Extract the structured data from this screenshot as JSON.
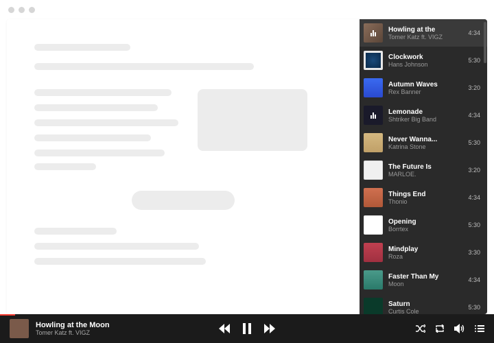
{
  "now_playing": {
    "title": "Howling at the Moon",
    "artist": "Tomer Katz ft. VIGZ"
  },
  "queue": [
    {
      "title": "Howling at the",
      "artist": "Tomer Katz ft. VIGZ",
      "duration": "4:34",
      "art": "art-a",
      "active": true,
      "playing": true
    },
    {
      "title": "Clockwork",
      "artist": "Hans Johnson",
      "duration": "5:30",
      "art": "art-b"
    },
    {
      "title": "Autumn Waves",
      "artist": "Rex Banner",
      "duration": "3:20",
      "art": "art-c"
    },
    {
      "title": "Lemonade",
      "artist": "Shtriker Big Band",
      "duration": "4:34",
      "art": "art-d",
      "playing": true
    },
    {
      "title": "Never Wanna...",
      "artist": "Katrina Stone",
      "duration": "5:30",
      "art": "art-e"
    },
    {
      "title": "The Future Is",
      "artist": "MARLOE.",
      "duration": "3:20",
      "art": "art-f"
    },
    {
      "title": "Things End",
      "artist": "Thonio",
      "duration": "4:34",
      "art": "art-g"
    },
    {
      "title": "Opening",
      "artist": "Borrtex",
      "duration": "5:30",
      "art": "art-h"
    },
    {
      "title": "Mindplay",
      "artist": "Roza",
      "duration": "3:30",
      "art": "art-i"
    },
    {
      "title": "Faster Than My",
      "artist": "Moon",
      "duration": "4:34",
      "art": "art-j"
    },
    {
      "title": "Saturn",
      "artist": "Curtis Cole",
      "duration": "5:30",
      "art": "art-k"
    }
  ]
}
